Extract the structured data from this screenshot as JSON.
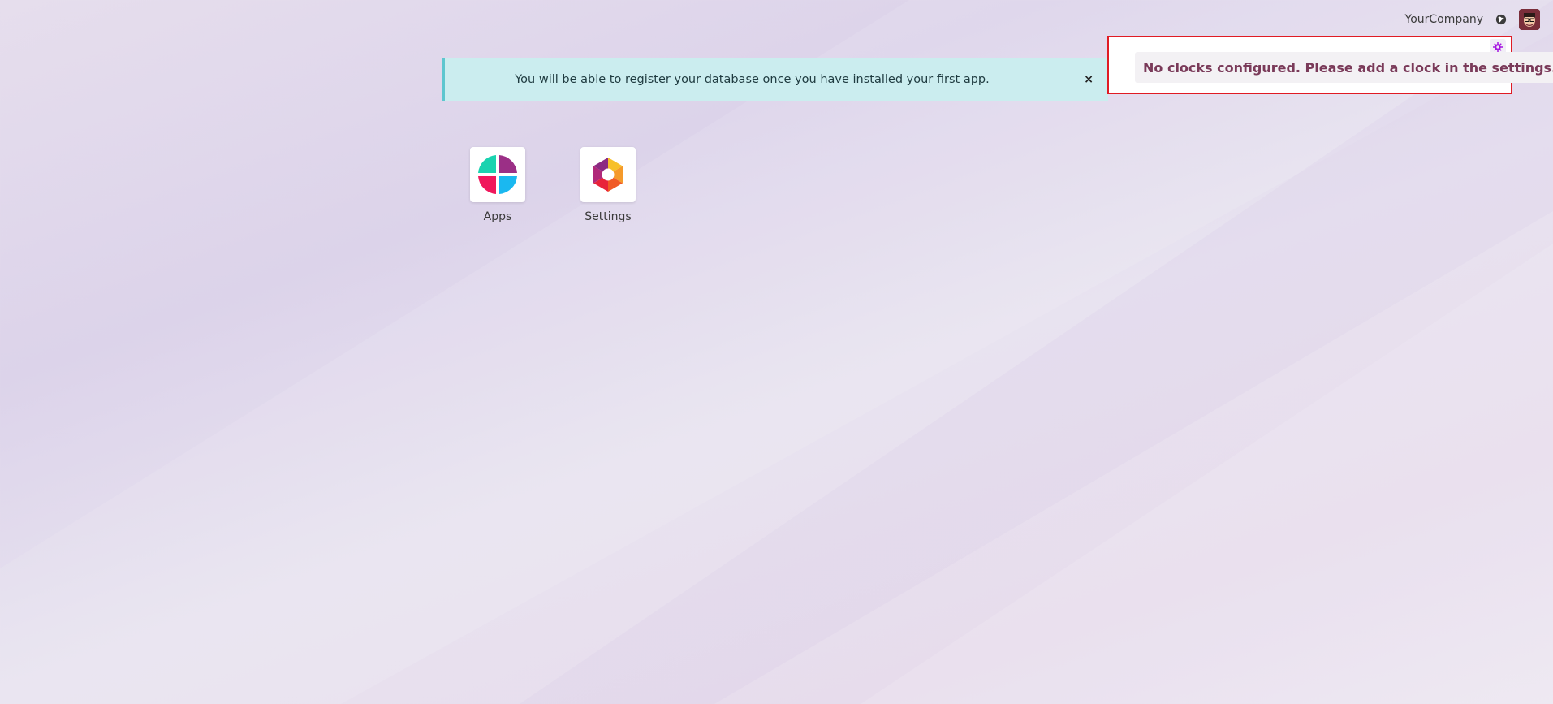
{
  "navbar": {
    "company_name": "YourCompany",
    "globe_icon": "globe-icon",
    "avatar_icon": "user-avatar"
  },
  "alert": {
    "message": "You will be able to register your database once you have installed your first app.",
    "close_label": "×"
  },
  "clock_widget": {
    "message": "No clocks configured. Please add a clock in the settings.",
    "settings_icon": "gear-icon",
    "border_color": "#e01b24",
    "text_color": "#7a3a59"
  },
  "apps": [
    {
      "label": "Apps",
      "icon": "apps-icon"
    },
    {
      "label": "Settings",
      "icon": "settings-icon"
    }
  ],
  "colors": {
    "alert_bg": "#cbedef",
    "alert_border": "#5ec6cf",
    "accent": "#a517e0"
  }
}
